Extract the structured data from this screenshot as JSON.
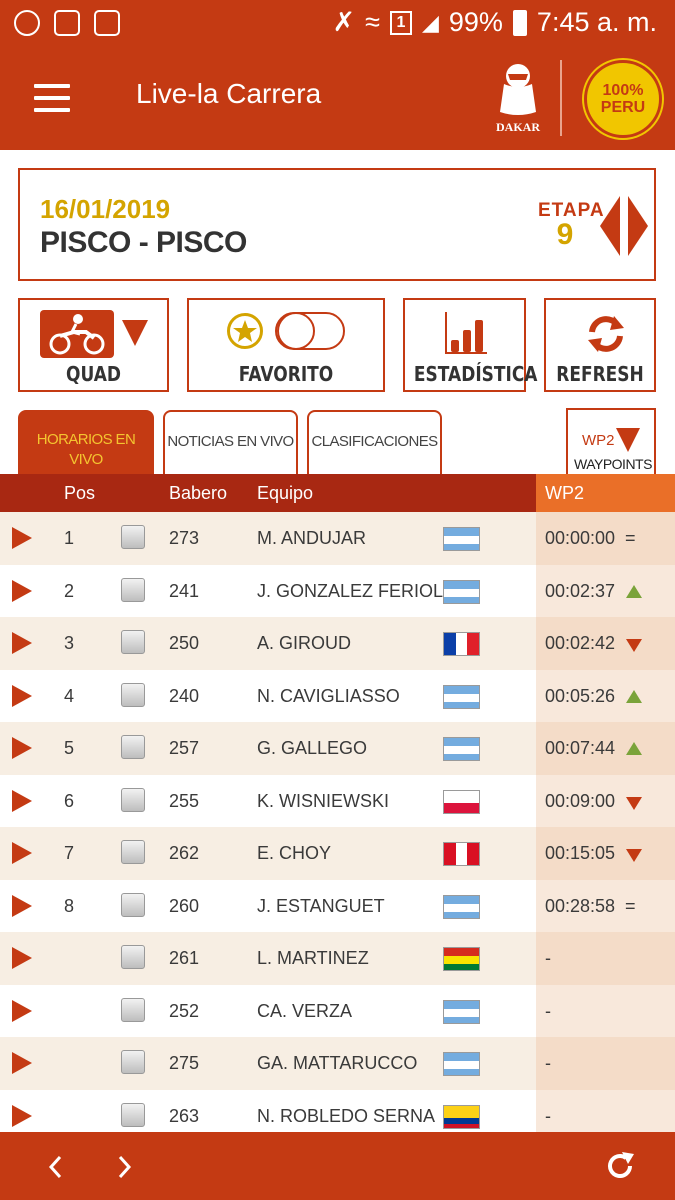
{
  "status_bar": {
    "sim_badge": "1",
    "battery": "99%",
    "time": "7:45 a. m."
  },
  "app_bar": {
    "title": "Live-la Carrera",
    "dakar_logo_text": "DAKAR",
    "peru_logo_text": "100% PERU"
  },
  "stage": {
    "date": "16/01/2019",
    "route": "PISCO - PISCO",
    "etapa_label": "ETAPA",
    "etapa_number": "9"
  },
  "controls": {
    "quad_label": "QUAD",
    "favorito_label": "FAVORITO",
    "estadistica_label": "ESTADÍSTICA",
    "refresh_label": "REFRESH"
  },
  "tabs": [
    {
      "label": "HORARIOS EN VIVO",
      "active": true
    },
    {
      "label": "NOTICIAS EN VIVO",
      "active": false
    },
    {
      "label": "CLASIFICACIONES",
      "active": false
    }
  ],
  "waypoint_selector": {
    "code": "WP2",
    "label": "WAYPOINTS"
  },
  "table": {
    "columns": {
      "pos": "Pos",
      "babero": "Babero",
      "equipo": "Equipo",
      "wp": "WP2"
    },
    "rows": [
      {
        "pos": "1",
        "babero": "273",
        "equipo": "M. ANDUJAR",
        "flag": "argentina",
        "time": "00:00:00",
        "trend": "same"
      },
      {
        "pos": "2",
        "babero": "241",
        "equipo": "J. GONZALEZ FERIOLI",
        "flag": "argentina",
        "time": "00:02:37",
        "trend": "up"
      },
      {
        "pos": "3",
        "babero": "250",
        "equipo": "A. GIROUD",
        "flag": "france",
        "time": "00:02:42",
        "trend": "down"
      },
      {
        "pos": "4",
        "babero": "240",
        "equipo": "N. CAVIGLIASSO",
        "flag": "argentina",
        "time": "00:05:26",
        "trend": "up"
      },
      {
        "pos": "5",
        "babero": "257",
        "equipo": "G. GALLEGO",
        "flag": "argentina",
        "time": "00:07:44",
        "trend": "up"
      },
      {
        "pos": "6",
        "babero": "255",
        "equipo": "K. WISNIEWSKI",
        "flag": "poland",
        "time": "00:09:00",
        "trend": "down"
      },
      {
        "pos": "7",
        "babero": "262",
        "equipo": "E. CHOY",
        "flag": "peru",
        "time": "00:15:05",
        "trend": "down"
      },
      {
        "pos": "8",
        "babero": "260",
        "equipo": "J. ESTANGUET",
        "flag": "argentina",
        "time": "00:28:58",
        "trend": "same"
      },
      {
        "pos": "",
        "babero": "261",
        "equipo": "L. MARTINEZ",
        "flag": "bolivia",
        "time": "-",
        "trend": "none"
      },
      {
        "pos": "",
        "babero": "252",
        "equipo": "CA. VERZA",
        "flag": "argentina",
        "time": "-",
        "trend": "none"
      },
      {
        "pos": "",
        "babero": "275",
        "equipo": "GA. MATTARUCCO",
        "flag": "argentina",
        "time": "-",
        "trend": "none"
      },
      {
        "pos": "",
        "babero": "263",
        "equipo": "N. ROBLEDO SERNA",
        "flag": "colombia",
        "time": "-",
        "trend": "none"
      }
    ]
  },
  "trend_symbols": {
    "same": "="
  },
  "colors": {
    "brand_red": "#c43a13",
    "header_dark_red": "#a82812",
    "wp_orange": "#ea6f28",
    "gold": "#d4a400",
    "up_green": "#7aa33a"
  },
  "icons": {
    "menu": "hamburger-icon",
    "back": "chevron-left-icon",
    "forward": "chevron-right-icon",
    "refresh": "refresh-icon",
    "quad": "quad-bike-icon",
    "favorite": "star-icon",
    "stats": "bar-chart-icon"
  }
}
